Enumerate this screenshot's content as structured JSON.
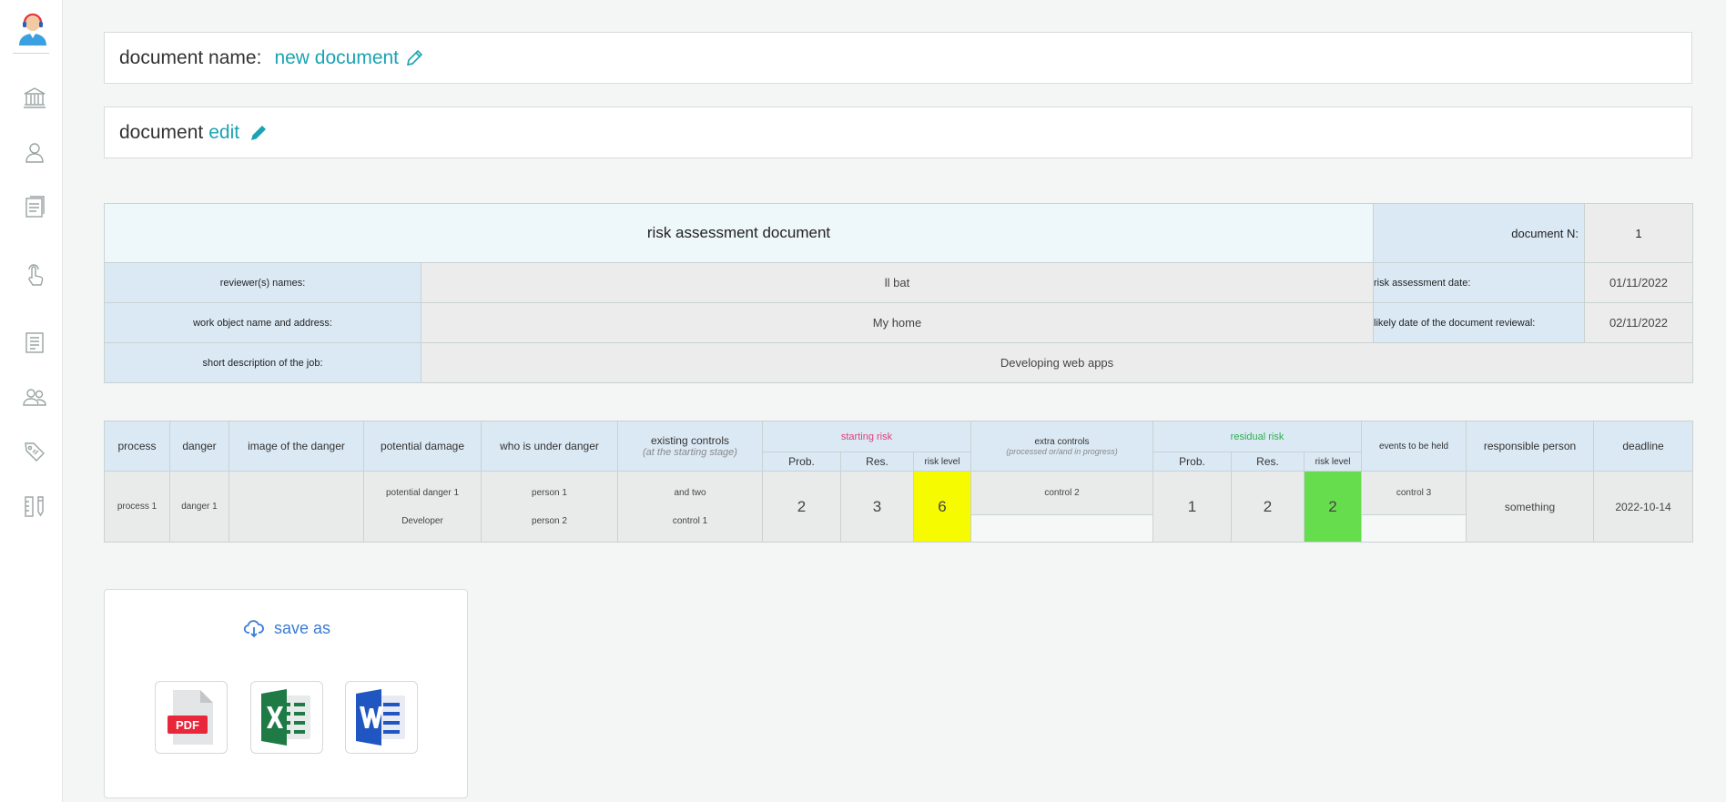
{
  "sidebar": {
    "icons": [
      "avatar-icon",
      "bank-icon",
      "user-icon",
      "document-list-icon",
      "touch-icon",
      "notes-icon",
      "group-icon",
      "tag-icon",
      "tools-icon"
    ]
  },
  "header": {
    "name_label": "document name:",
    "name_value": "new document",
    "edit_prefix": "document",
    "edit_link": "edit"
  },
  "info": {
    "title": "risk assessment document",
    "doc_n_label": "document N:",
    "doc_n_value": "1",
    "reviewers_label": "reviewer(s) names:",
    "reviewers_value": "ll bat",
    "date_label": "risk assessment date:",
    "date_value": "01/11/2022",
    "work_object_label": "work object name and address:",
    "work_object_value": "My home",
    "review_date_label": "likely date of the document reviewal:",
    "review_date_value": "02/11/2022",
    "job_label": "short description of the job:",
    "job_value": "Developing web apps"
  },
  "risk_table": {
    "headers": {
      "process": "process",
      "danger": "danger",
      "image": "image of the danger",
      "damage": "potential damage",
      "who": "who is under danger",
      "controls": "existing controls",
      "controls_sub": "(at the starting stage)",
      "starting_risk": "starting risk",
      "extra_controls": "extra controls",
      "extra_controls_sub": "(processed or/and in progress)",
      "residual_risk": "residual risk",
      "events": "events to be held",
      "responsible": "responsible person",
      "deadline": "deadline",
      "prob": "Prob.",
      "res": "Res.",
      "risk_level": "risk level"
    },
    "row": {
      "process": "process 1",
      "danger": "danger 1",
      "damage_1": "potential danger 1",
      "damage_2": "Developer",
      "who_1": "person 1",
      "who_2": "person 2",
      "controls_1": "and two",
      "controls_2": "control 1",
      "start_prob": "2",
      "start_res": "3",
      "start_level": "6",
      "extra_control": "control 2",
      "res_prob": "1",
      "res_res": "2",
      "res_level": "2",
      "events": "control 3",
      "responsible": "something",
      "deadline": "2022-10-14"
    }
  },
  "save": {
    "label": "save as",
    "formats": [
      "PDF",
      "Excel",
      "Word"
    ]
  },
  "colors": {
    "accent": "#1aa3b3",
    "save_blue": "#3a7bd5",
    "level_yellow": "#f6fb00",
    "level_green": "#66dd4c"
  }
}
